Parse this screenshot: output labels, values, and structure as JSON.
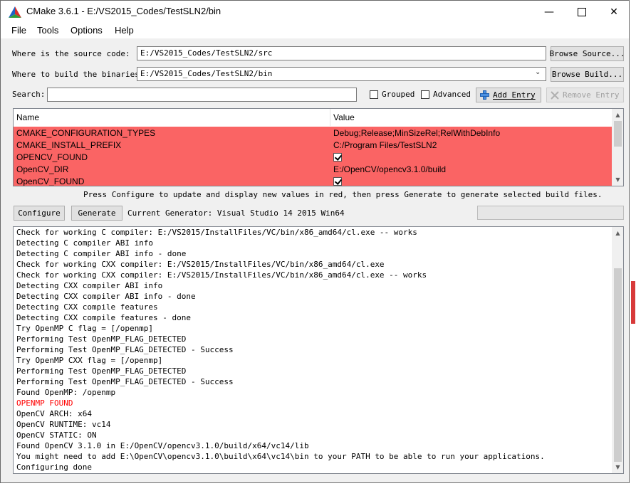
{
  "window": {
    "title": "CMake 3.6.1 - E:/VS2015_Codes/TestSLN2/bin"
  },
  "menu": [
    "File",
    "Tools",
    "Options",
    "Help"
  ],
  "source": {
    "label": "Where is the source code:",
    "value": "E:/VS2015_Codes/TestSLN2/src",
    "button": "Browse Source..."
  },
  "build": {
    "label": "Where to build the binaries:",
    "value": "E:/VS2015_Codes/TestSLN2/bin",
    "button": "Browse Build..."
  },
  "search": {
    "label": "Search:",
    "value": ""
  },
  "options": {
    "grouped": "Grouped",
    "advanced": "Advanced",
    "add_entry": "Add Entry",
    "remove_entry": "Remove Entry"
  },
  "table": {
    "headers": [
      "Name",
      "Value"
    ],
    "rows": [
      {
        "name": "CMAKE_CONFIGURATION_TYPES",
        "value": "Debug;Release;MinSizeRel;RelWithDebInfo",
        "checkbox": false
      },
      {
        "name": "CMAKE_INSTALL_PREFIX",
        "value": "C:/Program Files/TestSLN2",
        "checkbox": false
      },
      {
        "name": "OPENCV_FOUND",
        "value": "",
        "checkbox": true
      },
      {
        "name": "OpenCV_DIR",
        "value": "E:/OpenCV/opencv3.1.0/build",
        "checkbox": false
      },
      {
        "name": "OpenCV_FOUND",
        "value": "",
        "checkbox": true
      }
    ]
  },
  "hint": "Press Configure to update and display new values in red, then press Generate to generate selected build files.",
  "actions": {
    "configure": "Configure",
    "generate": "Generate",
    "generator": "Current Generator: Visual Studio 14 2015 Win64"
  },
  "colors": {
    "changed_row": "#fa6464",
    "error_text": "#ff0000"
  },
  "output": [
    {
      "text": "Check for working C compiler: E:/VS2015/InstallFiles/VC/bin/x86_amd64/cl.exe -- works",
      "red": false
    },
    {
      "text": "Detecting C compiler ABI info",
      "red": false
    },
    {
      "text": "Detecting C compiler ABI info - done",
      "red": false
    },
    {
      "text": "Check for working CXX compiler: E:/VS2015/InstallFiles/VC/bin/x86_amd64/cl.exe",
      "red": false
    },
    {
      "text": "Check for working CXX compiler: E:/VS2015/InstallFiles/VC/bin/x86_amd64/cl.exe -- works",
      "red": false
    },
    {
      "text": "Detecting CXX compiler ABI info",
      "red": false
    },
    {
      "text": "Detecting CXX compiler ABI info - done",
      "red": false
    },
    {
      "text": "Detecting CXX compile features",
      "red": false
    },
    {
      "text": "Detecting CXX compile features - done",
      "red": false
    },
    {
      "text": "Try OpenMP C flag = [/openmp]",
      "red": false
    },
    {
      "text": "Performing Test OpenMP_FLAG_DETECTED",
      "red": false
    },
    {
      "text": "Performing Test OpenMP_FLAG_DETECTED - Success",
      "red": false
    },
    {
      "text": "Try OpenMP CXX flag = [/openmp]",
      "red": false
    },
    {
      "text": "Performing Test OpenMP_FLAG_DETECTED",
      "red": false
    },
    {
      "text": "Performing Test OpenMP_FLAG_DETECTED - Success",
      "red": false
    },
    {
      "text": "Found OpenMP: /openmp",
      "red": false
    },
    {
      "text": "OPENMP FOUND",
      "red": true
    },
    {
      "text": "OpenCV ARCH: x64",
      "red": false
    },
    {
      "text": "OpenCV RUNTIME: vc14",
      "red": false
    },
    {
      "text": "OpenCV STATIC: ON",
      "red": false
    },
    {
      "text": "Found OpenCV 3.1.0 in E:/OpenCV/opencv3.1.0/build/x64/vc14/lib",
      "red": false
    },
    {
      "text": "You might need to add E:\\OpenCV\\opencv3.1.0\\build\\x64\\vc14\\bin to your PATH to be able to run your applications.",
      "red": false
    },
    {
      "text": "Configuring done",
      "red": false
    }
  ]
}
